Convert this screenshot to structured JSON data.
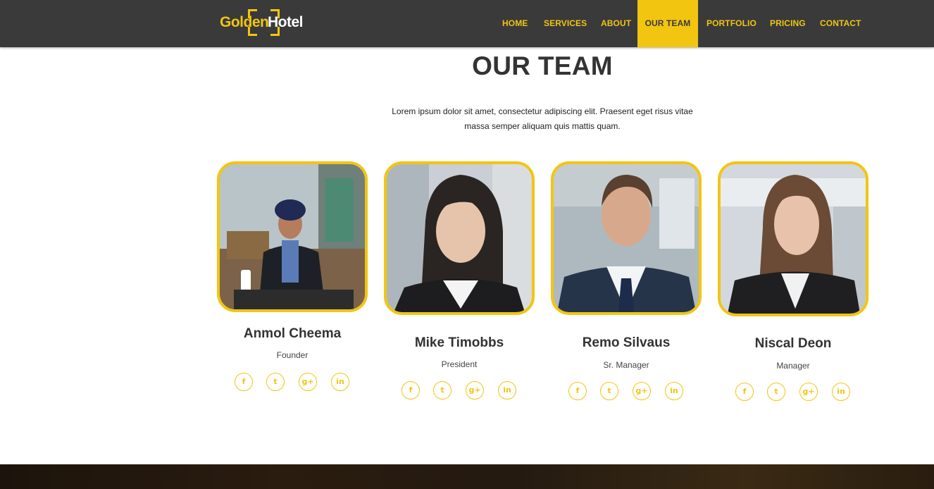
{
  "brand": {
    "word1": "Golden",
    "word2": "Hotel"
  },
  "nav": {
    "items": [
      {
        "label": "HOME"
      },
      {
        "label": "SERVICES"
      },
      {
        "label": "ABOUT"
      },
      {
        "label": "OUR TEAM",
        "active": true
      },
      {
        "label": "PORTFOLIO"
      },
      {
        "label": "PRICING"
      },
      {
        "label": "CONTACT"
      }
    ]
  },
  "section": {
    "title": "OUR TEAM",
    "description": "Lorem ipsum dolor sit amet, consectetur adipiscing elit. Praesent eget risus vitae massa semper aliquam quis mattis quam."
  },
  "team": [
    {
      "name": "Anmol Cheema",
      "role": "Founder"
    },
    {
      "name": "Mike Timobbs",
      "role": "President"
    },
    {
      "name": "Remo Silvaus",
      "role": "Sr. Manager"
    },
    {
      "name": "Niscal Deon",
      "role": "Manager"
    }
  ],
  "social": {
    "facebook": "f",
    "twitter": "t",
    "googleplus": "g+",
    "linkedin": "in"
  },
  "colors": {
    "accent": "#f2c511",
    "navbar": "#3a3a3a",
    "heading": "#333333"
  }
}
